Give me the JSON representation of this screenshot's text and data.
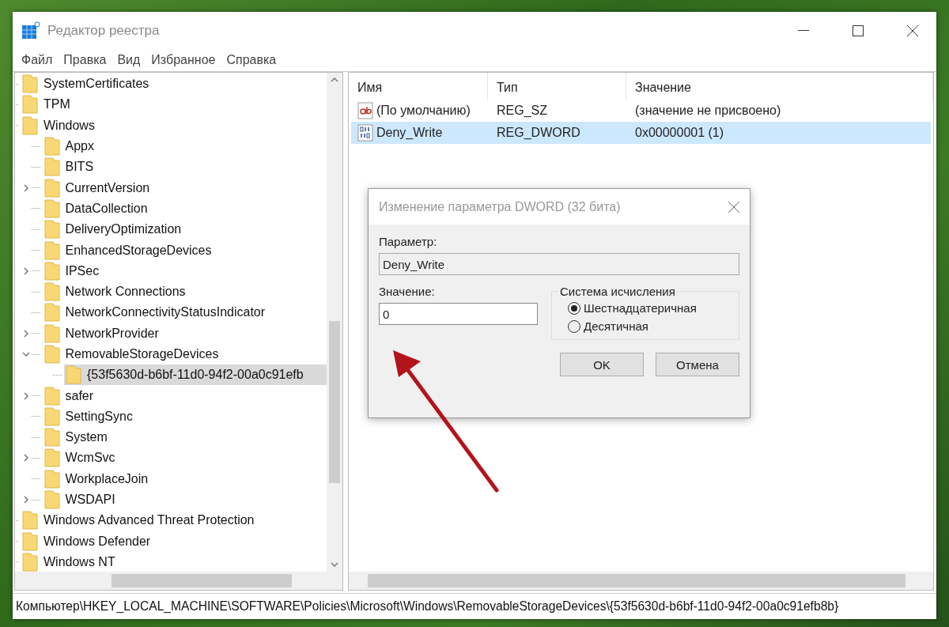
{
  "window": {
    "title": "Редактор реестра"
  },
  "menu": [
    "Файл",
    "Правка",
    "Вид",
    "Избранное",
    "Справка"
  ],
  "tree": [
    {
      "label": "SystemCertificates",
      "kind": "node",
      "selected": false
    },
    {
      "label": "TPM",
      "kind": "node",
      "selected": false
    },
    {
      "label": "Windows",
      "kind": "node",
      "selected": false,
      "children": [
        {
          "label": "Appx",
          "kind": "node",
          "selected": false
        },
        {
          "label": "BITS",
          "kind": "node",
          "selected": false
        },
        {
          "label": "CurrentVersion",
          "kind": "branch",
          "expanded": false,
          "selected": false
        },
        {
          "label": "DataCollection",
          "kind": "node",
          "selected": false
        },
        {
          "label": "DeliveryOptimization",
          "kind": "node",
          "selected": false
        },
        {
          "label": "EnhancedStorageDevices",
          "kind": "node",
          "selected": false
        },
        {
          "label": "IPSec",
          "kind": "branch",
          "expanded": false,
          "selected": false
        },
        {
          "label": "Network Connections",
          "kind": "node",
          "selected": false
        },
        {
          "label": "NetworkConnectivityStatusIndicator",
          "kind": "node",
          "selected": false
        },
        {
          "label": "NetworkProvider",
          "kind": "branch",
          "expanded": false,
          "selected": false
        },
        {
          "label": "RemovableStorageDevices",
          "kind": "branch",
          "expanded": true,
          "selected": false,
          "children": [
            {
              "label": "{53f5630d-b6bf-11d0-94f2-00a0c91efb",
              "kind": "node",
              "selected": true
            }
          ]
        },
        {
          "label": "safer",
          "kind": "branch",
          "expanded": false,
          "selected": false
        },
        {
          "label": "SettingSync",
          "kind": "node",
          "selected": false
        },
        {
          "label": "System",
          "kind": "node",
          "selected": false
        },
        {
          "label": "WcmSvc",
          "kind": "branch",
          "expanded": false,
          "selected": false
        },
        {
          "label": "WorkplaceJoin",
          "kind": "node",
          "selected": false
        },
        {
          "label": "WSDAPI",
          "kind": "branch",
          "expanded": false,
          "selected": false
        }
      ]
    },
    {
      "label": "Windows Advanced Threat Protection",
      "kind": "node",
      "selected": false
    },
    {
      "label": "Windows Defender",
      "kind": "node",
      "selected": false
    },
    {
      "label": "Windows NT",
      "kind": "node",
      "selected": false
    }
  ],
  "values": {
    "columns": [
      "Имя",
      "Тип",
      "Значение"
    ],
    "rows": [
      {
        "kind": "string",
        "name": "(По умолчанию)",
        "type": "REG_SZ",
        "value": "(значение не присвоено)",
        "selected": false
      },
      {
        "kind": "binary",
        "name": "Deny_Write",
        "type": "REG_DWORD",
        "value": "0x00000001 (1)",
        "selected": true
      }
    ]
  },
  "dialog": {
    "title": "Изменение параметра DWORD (32 бита)",
    "param_label": "Параметр:",
    "param_value": "Deny_Write",
    "value_label": "Значение:",
    "value": "0",
    "base_group": "Система исчисления",
    "bases": [
      {
        "label": "Шестнадцатеричная",
        "selected": true
      },
      {
        "label": "Десятичная",
        "selected": false
      }
    ],
    "buttons": [
      "OK",
      "Отмена"
    ]
  },
  "status_bar": "Компьютер\\HKEY_LOCAL_MACHINE\\SOFTWARE\\Policies\\Microsoft\\Windows\\RemovableStorageDevices\\{53f5630d-b6bf-11d0-94f2-00a0c91efb8b}"
}
